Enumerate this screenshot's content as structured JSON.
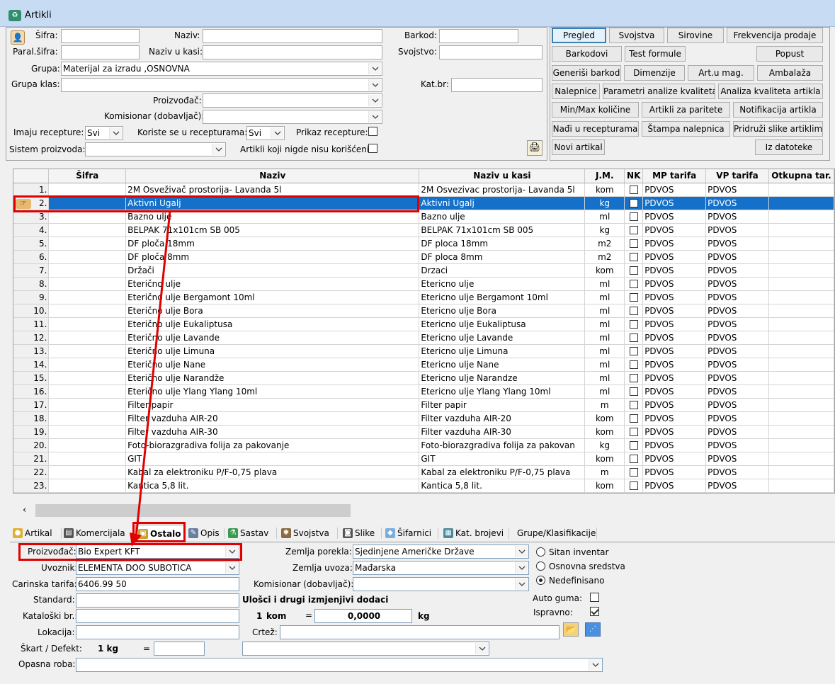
{
  "window": {
    "title": "Artikli"
  },
  "filters": {
    "sifra_label": "Šifra:",
    "naziv_label": "Naziv:",
    "barkod_label": "Barkod:",
    "paral_sifra_label": "Paral.šifra:",
    "naziv_u_kasi_label": "Naziv u kasi:",
    "svojstvo_label": "Svojstvo:",
    "grupa_label": "Grupa:",
    "grupa_value": "Materijal za izradu ,OSNOVNA",
    "grupa_klas_label": "Grupa klas:",
    "kat_br_label": "Kat.br:",
    "proizvodjac_label": "Proizvođač:",
    "komisionar_label": "Komisionar (dobavljač):",
    "imaju_recepture_label": "Imaju recepture:",
    "imaju_recepture_value": "Svi",
    "koriste_se_label": "Koriste se u recepturama:",
    "koriste_se_value": "Svi",
    "prikaz_recepture_label": "Prikaz recepture:",
    "sistem_proizvoda_label": "Sistem proizvoda:",
    "nigde_label": "Artikli koji nigde nisu korišćeni:"
  },
  "buttons": {
    "pregled": "Pregled",
    "svojstva": "Svojstva",
    "sirovine": "Sirovine",
    "frekvencija": "Frekvencija prodaje",
    "barkodovi": "Barkodovi",
    "test_formule": "Test formule",
    "popust": "Popust",
    "generisi_barkod": "Generiši barkod",
    "dimenzije": "Dimenzije",
    "art_u_mag": "Art.u mag.",
    "ambalaza": "Ambalaža",
    "nalepnice": "Nalepnice",
    "parametri": "Parametri analize kvaliteta",
    "analiza": "Analiza kvaliteta artikla",
    "minmax": "Min/Max količine",
    "paritete": "Artikli za paritete",
    "notifikacija": "Notifikacija artikla",
    "nadji": "Nađi u recepturama",
    "stampa": "Štampa nalepnica",
    "pridruzi": "Pridruži slike artiklima",
    "novi": "Novi artikal",
    "iz_datoteke": "Iz datoteke"
  },
  "grid": {
    "columns": [
      "Šifra",
      "Naziv",
      "Naziv u kasi",
      "J.M.",
      "NK",
      "MP tarifa",
      "VP tarifa",
      "Otkupna tar."
    ],
    "rows": [
      {
        "n": "1.",
        "naziv": "2M Osveživač prostorija- Lavanda 5l",
        "kasa": "2M Osvezivac prostorija- Lavanda 5l",
        "jm": "kom",
        "mp": "PDVOS",
        "vp": "PDVOS"
      },
      {
        "n": "2.",
        "naziv": "Aktivni Ugalj",
        "kasa": "Aktivni Ugalj",
        "jm": "kg",
        "mp": "PDVOS",
        "vp": "PDVOS"
      },
      {
        "n": "3.",
        "naziv": "Bazno ulje",
        "kasa": "Bazno ulje",
        "jm": "ml",
        "mp": "PDVOS",
        "vp": "PDVOS"
      },
      {
        "n": "4.",
        "naziv": "BELPAK 71x101cm SB 005",
        "kasa": "BELPAK 71x101cm SB 005",
        "jm": "kg",
        "mp": "PDVOS",
        "vp": "PDVOS"
      },
      {
        "n": "5.",
        "naziv": "DF ploča 18mm",
        "kasa": "DF ploca 18mm",
        "jm": "m2",
        "mp": "PDVOS",
        "vp": "PDVOS"
      },
      {
        "n": "6.",
        "naziv": "DF ploča 8mm",
        "kasa": "DF ploca 8mm",
        "jm": "m2",
        "mp": "PDVOS",
        "vp": "PDVOS"
      },
      {
        "n": "7.",
        "naziv": "Držači",
        "kasa": "Drzaci",
        "jm": "kom",
        "mp": "PDVOS",
        "vp": "PDVOS"
      },
      {
        "n": "8.",
        "naziv": "Eterično ulje",
        "kasa": "Etericno ulje",
        "jm": "ml",
        "mp": "PDVOS",
        "vp": "PDVOS"
      },
      {
        "n": "9.",
        "naziv": "Eterično ulje Bergamont 10ml",
        "kasa": "Etericno ulje Bergamont 10ml",
        "jm": "ml",
        "mp": "PDVOS",
        "vp": "PDVOS"
      },
      {
        "n": "10.",
        "naziv": "Eterično ulje Bora",
        "kasa": "Etericno ulje Bora",
        "jm": "ml",
        "mp": "PDVOS",
        "vp": "PDVOS"
      },
      {
        "n": "11.",
        "naziv": "Eterično ulje Eukaliptusa",
        "kasa": "Etericno ulje Eukaliptusa",
        "jm": "ml",
        "mp": "PDVOS",
        "vp": "PDVOS"
      },
      {
        "n": "12.",
        "naziv": "Eterično ulje Lavande",
        "kasa": "Etericno ulje Lavande",
        "jm": "ml",
        "mp": "PDVOS",
        "vp": "PDVOS"
      },
      {
        "n": "13.",
        "naziv": "Eterično ulje Limuna",
        "kasa": "Etericno ulje Limuna",
        "jm": "ml",
        "mp": "PDVOS",
        "vp": "PDVOS"
      },
      {
        "n": "14.",
        "naziv": "Eterično ulje Nane",
        "kasa": "Etericno ulje Nane",
        "jm": "ml",
        "mp": "PDVOS",
        "vp": "PDVOS"
      },
      {
        "n": "15.",
        "naziv": "Eterično ulje Narandže",
        "kasa": "Etericno ulje Narandze",
        "jm": "ml",
        "mp": "PDVOS",
        "vp": "PDVOS"
      },
      {
        "n": "16.",
        "naziv": "Eterično ulje Ylang Ylang 10ml",
        "kasa": "Etericno ulje Ylang Ylang 10ml",
        "jm": "ml",
        "mp": "PDVOS",
        "vp": "PDVOS"
      },
      {
        "n": "17.",
        "naziv": "Filter papir",
        "kasa": "Filter papir",
        "jm": "m",
        "mp": "PDVOS",
        "vp": "PDVOS"
      },
      {
        "n": "18.",
        "naziv": "Filter vazduha AIR-20",
        "kasa": "Filter vazduha AIR-20",
        "jm": "kom",
        "mp": "PDVOS",
        "vp": "PDVOS"
      },
      {
        "n": "19.",
        "naziv": "Filter vazduha AIR-30",
        "kasa": "Filter vazduha AIR-30",
        "jm": "kom",
        "mp": "PDVOS",
        "vp": "PDVOS"
      },
      {
        "n": "20.",
        "naziv": "Foto-biorazgradiva folija za pakovanje",
        "kasa": "Foto-biorazgradiva folija za pakovan",
        "jm": "kg",
        "mp": "PDVOS",
        "vp": "PDVOS"
      },
      {
        "n": "21.",
        "naziv": "GIT",
        "kasa": "GIT",
        "jm": "kom",
        "mp": "PDVOS",
        "vp": "PDVOS"
      },
      {
        "n": "22.",
        "naziv": "Kabal za elektroniku P/F-0,75 plava",
        "kasa": "Kabal za elektroniku P/F-0,75 plava",
        "jm": "m",
        "mp": "PDVOS",
        "vp": "PDVOS"
      },
      {
        "n": "23.",
        "naziv": "Kantica 5,8 lit.",
        "kasa": "Kantica 5,8 lit.",
        "jm": "kom",
        "mp": "PDVOS",
        "vp": "PDVOS"
      }
    ]
  },
  "tabs": {
    "artikal": "Artikal",
    "komercijala": "Komercijala",
    "ostalo": "Ostalo",
    "opis": "Opis",
    "sastav": "Sastav",
    "svojstva": "Svojstva",
    "slike": "Slike",
    "sifarnici": "Šifarnici",
    "kat_brojevi": "Kat. brojevi",
    "grupe": "Grupe/Klasifikacije"
  },
  "detail": {
    "proizvodjac_label": "Proizvođač:",
    "proizvodjac_value": "Bio Expert KFT",
    "uvoznik_label": "Uvoznik:",
    "uvoznik_value": "ELEMENTA DOO SUBOTICA",
    "carinska_label": "Carinska tarifa:",
    "carinska_value": "6406.99 50",
    "standard_label": "Standard:",
    "katalogski_label": "Kataloški br.:",
    "lokacija_label": "Lokacija:",
    "skart_label": "Škart / Defekt:",
    "skart_qty": "1 kg",
    "eq": "=",
    "opasna_label": "Opasna roba:",
    "zemlja_porekla_label": "Zemlja porekla:",
    "zemlja_porekla_value": "Sjedinjene Američke Države",
    "zemlja_uvoza_label": "Zemlja uvoza:",
    "zemlja_uvoza_value": "Mađarska",
    "komisionar_label": "Komisionar (dobavljač):",
    "ulosci_label": "Ulošci i drugi izmjenjivi dodaci",
    "kom_qty": "1",
    "kom_unit": "kom",
    "ulosci_value": "0,0000",
    "kg_unit": "kg",
    "crtez_label": "Crtež:",
    "sitan_inventar": "Sitan inventar",
    "osnovna_sredstva": "Osnovna sredstva",
    "nedefinisano": "Nedefinisano",
    "auto_guma": "Auto guma:",
    "ispravno": "Ispravno:"
  }
}
